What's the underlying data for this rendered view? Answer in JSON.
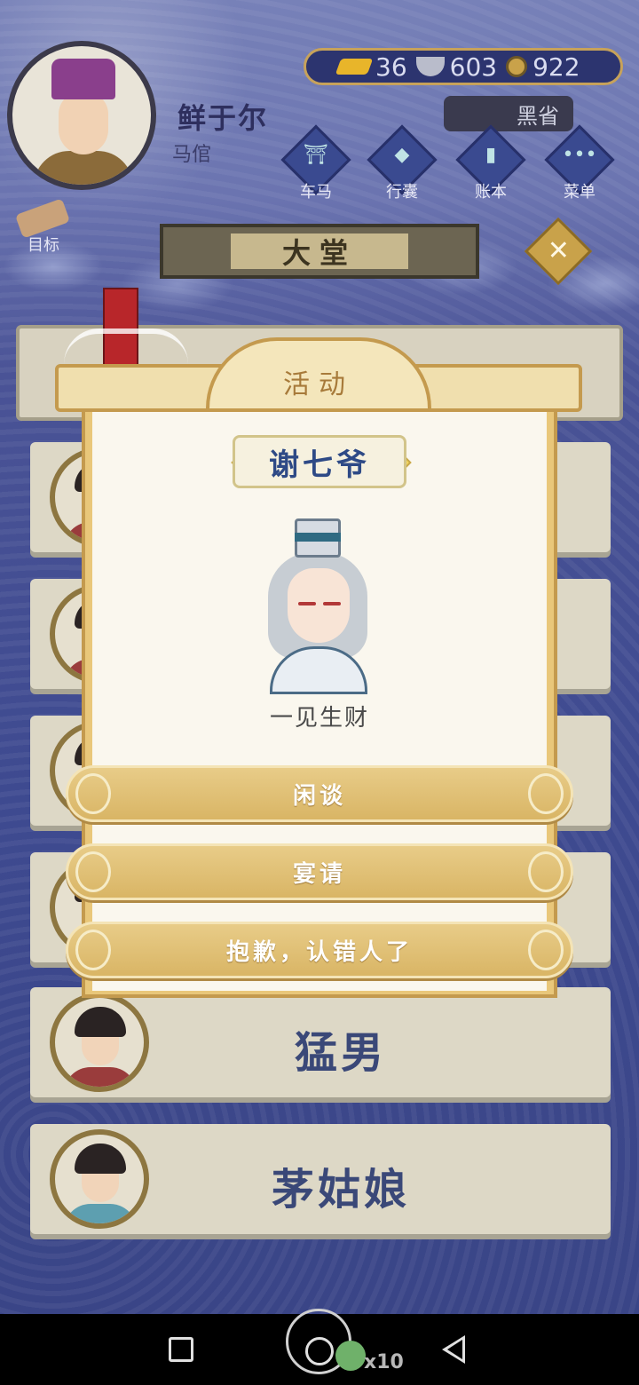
{
  "header": {
    "player_name": "鲜于尔",
    "player_title": "马倌",
    "currency": {
      "gold": "36",
      "silver": "603",
      "coin": "922"
    },
    "heisheng_label": "黑省",
    "menu": [
      {
        "label": "车马",
        "icon": "carriage-icon",
        "glyph": "⛩"
      },
      {
        "label": "行囊",
        "icon": "bag-icon",
        "glyph": "◆"
      },
      {
        "label": "账本",
        "icon": "ledger-icon",
        "glyph": "▮"
      },
      {
        "label": "菜单",
        "icon": "more-icon",
        "glyph": "•••"
      }
    ],
    "goal_label": "目标"
  },
  "hall": {
    "title": "大堂",
    "close_symbol": "✕"
  },
  "dialog": {
    "title": "活动",
    "npc_name": "谢七爷",
    "npc_desc": "一见生财",
    "options": [
      "闲谈",
      "宴请",
      "抱歉，认错人了"
    ]
  },
  "list": [
    {
      "name": "猛男"
    },
    {
      "name": "茅姑娘"
    }
  ],
  "navbar": {
    "float_count": "x10"
  },
  "colors": {
    "accent_gold": "#d9b565",
    "name_blue": "#2e4a86",
    "panel_bg": "#faf7ee"
  }
}
